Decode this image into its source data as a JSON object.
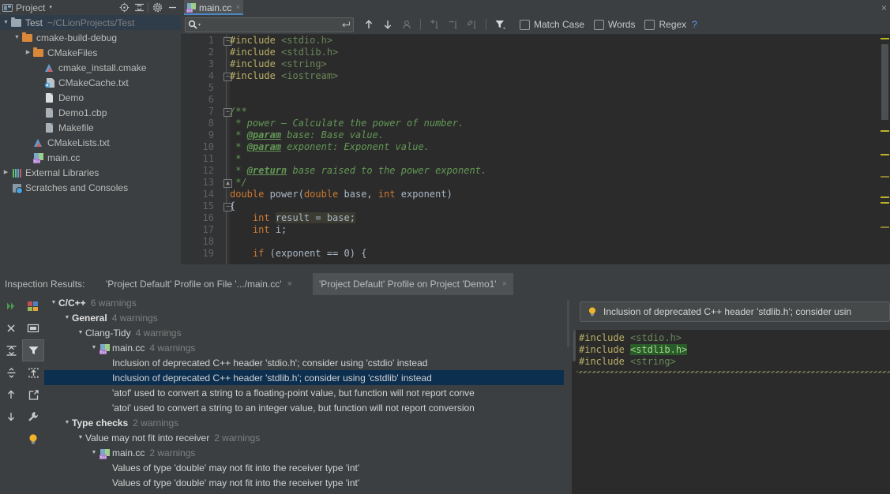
{
  "project_panel": {
    "title": "Project",
    "caret": "▾",
    "icons": [
      "project-icon",
      "locate-icon",
      "collapse-all-icon",
      "settings-gear-icon",
      "minimize-icon"
    ],
    "tree": [
      {
        "label": "Test",
        "sub": "~/CLionProjects/Test",
        "arrow": "▼",
        "icon": "folder-gray",
        "indent": 0,
        "selected": true
      },
      {
        "label": "cmake-build-debug",
        "sub": "",
        "arrow": "▼",
        "icon": "folder-orange",
        "indent": 1,
        "selected": false
      },
      {
        "label": "CMakeFiles",
        "sub": "",
        "arrow": "▶",
        "icon": "folder-orange",
        "indent": 2,
        "selected": false
      },
      {
        "label": "cmake_install.cmake",
        "sub": "",
        "arrow": "",
        "icon": "cmake-icon",
        "indent": 3,
        "selected": false
      },
      {
        "label": "CMakeCache.txt",
        "sub": "",
        "arrow": "",
        "icon": "cmake-cache-icon",
        "indent": 3,
        "selected": false
      },
      {
        "label": "Demo",
        "sub": "",
        "arrow": "",
        "icon": "file-white-icon",
        "indent": 3,
        "selected": false
      },
      {
        "label": "Demo1.cbp",
        "sub": "",
        "arrow": "",
        "icon": "file-gray-icon",
        "indent": 3,
        "selected": false
      },
      {
        "label": "Makefile",
        "sub": "",
        "arrow": "",
        "icon": "file-gray-icon",
        "indent": 3,
        "selected": false
      },
      {
        "label": "CMakeLists.txt",
        "sub": "",
        "arrow": "",
        "icon": "cmake-icon",
        "indent": 2,
        "selected": false
      },
      {
        "label": "main.cc",
        "sub": "",
        "arrow": "",
        "icon": "cpp-file-icon",
        "indent": 2,
        "selected": false
      },
      {
        "label": "External Libraries",
        "sub": "",
        "arrow": "▶",
        "icon": "libraries-icon",
        "indent": 0,
        "selected": false
      },
      {
        "label": "Scratches and Consoles",
        "sub": "",
        "arrow": "",
        "icon": "scratches-icon",
        "indent": 0,
        "selected": false
      }
    ]
  },
  "editor": {
    "tab": {
      "label": "main.cc",
      "close": "×",
      "icon": "cpp-file-icon"
    },
    "tabbar_close": "×",
    "search": {
      "value": "",
      "placeholder": "",
      "magnifier": "search-icon",
      "dropdown": "▾",
      "enter_key": "enter-key-icon"
    },
    "toolbar_buttons": [
      {
        "name": "find-previous-icon",
        "glyph": "↑"
      },
      {
        "name": "find-next-icon",
        "glyph": "↓"
      },
      {
        "name": "select-all-occurrences-icon",
        "glyph": "●"
      },
      {
        "name": "add-line-icon",
        "glyph": ""
      },
      {
        "name": "remove-line-icon",
        "glyph": ""
      },
      {
        "name": "edit-line-icon",
        "glyph": ""
      },
      {
        "name": "filter-icon",
        "glyph": ""
      }
    ],
    "checkboxes": [
      {
        "label": "Match Case",
        "checked": false
      },
      {
        "label": "Words",
        "checked": false
      },
      {
        "label": "Regex",
        "checked": false
      }
    ],
    "help": "?",
    "help_color": "#589df6",
    "lines": [
      {
        "num": "1",
        "fold": "−",
        "tokens": [
          {
            "t": "#include ",
            "c": "inc"
          },
          {
            "t": "<stdio.h>",
            "c": "str"
          }
        ]
      },
      {
        "num": "2",
        "fold": "",
        "tokens": [
          {
            "t": "#include ",
            "c": "inc"
          },
          {
            "t": "<stdlib.h>",
            "c": "str"
          }
        ]
      },
      {
        "num": "3",
        "fold": "",
        "tokens": [
          {
            "t": "#include ",
            "c": "inc"
          },
          {
            "t": "<string>",
            "c": "str"
          }
        ]
      },
      {
        "num": "4",
        "fold": "−",
        "tokens": [
          {
            "t": "#include ",
            "c": "inc"
          },
          {
            "t": "<iostream>",
            "c": "str"
          }
        ]
      },
      {
        "num": "5",
        "fold": "",
        "tokens": []
      },
      {
        "num": "6",
        "fold": "",
        "tokens": []
      },
      {
        "num": "7",
        "fold": "−",
        "tokens": [
          {
            "t": "/**",
            "c": "cmt"
          }
        ]
      },
      {
        "num": "8",
        "fold": "",
        "tokens": [
          {
            "t": " * power – Calculate the power of number.",
            "c": "cmt"
          }
        ]
      },
      {
        "num": "9",
        "fold": "",
        "tokens": [
          {
            "t": " * ",
            "c": "cmt"
          },
          {
            "t": "@param",
            "c": "tag"
          },
          {
            "t": " base: Base value.",
            "c": "cmt"
          }
        ]
      },
      {
        "num": "10",
        "fold": "",
        "tokens": [
          {
            "t": " * ",
            "c": "cmt"
          },
          {
            "t": "@param",
            "c": "tag"
          },
          {
            "t": " exponent: Exponent value.",
            "c": "cmt"
          }
        ]
      },
      {
        "num": "11",
        "fold": "",
        "tokens": [
          {
            "t": " *",
            "c": "cmt"
          }
        ]
      },
      {
        "num": "12",
        "fold": "",
        "tokens": [
          {
            "t": " * ",
            "c": "cmt"
          },
          {
            "t": "@return",
            "c": "tag"
          },
          {
            "t": " base raised to the power exponent.",
            "c": "cmt"
          }
        ]
      },
      {
        "num": "13",
        "fold": "▲",
        "tokens": [
          {
            "t": " */",
            "c": "cmt"
          }
        ]
      },
      {
        "num": "14",
        "fold": "",
        "tokens": [
          {
            "t": "double ",
            "c": "kw"
          },
          {
            "t": "power(",
            "c": "pln"
          },
          {
            "t": "double ",
            "c": "kw"
          },
          {
            "t": "base, ",
            "c": "pln"
          },
          {
            "t": "int ",
            "c": "kw"
          },
          {
            "t": "exponent)",
            "c": "pln"
          }
        ]
      },
      {
        "num": "15",
        "fold": "−",
        "tokens": [
          {
            "t": "{",
            "c": "pln"
          }
        ]
      },
      {
        "num": "16",
        "fold": "",
        "tokens": [
          {
            "t": "    ",
            "c": "pln"
          },
          {
            "t": "int ",
            "c": "kw"
          },
          {
            "t": "result = base;",
            "c": "pln hl"
          }
        ]
      },
      {
        "num": "17",
        "fold": "",
        "tokens": [
          {
            "t": "    ",
            "c": "pln"
          },
          {
            "t": "int ",
            "c": "kw"
          },
          {
            "t": "i;",
            "c": "pln"
          }
        ]
      },
      {
        "num": "18",
        "fold": "",
        "tokens": []
      },
      {
        "num": "19",
        "fold": "",
        "tokens": [
          {
            "t": "    ",
            "c": "pln"
          },
          {
            "t": "if ",
            "c": "kw"
          },
          {
            "t": "(exponent == 0) {",
            "c": "pln"
          }
        ]
      }
    ],
    "scroll_markers": [
      "#bbb529",
      "#bbb529",
      "#bbb529",
      "#8a7f33",
      "#bbb529",
      "#bbb529",
      "#8a7f33"
    ]
  },
  "inspection": {
    "label": "Inspection Results:",
    "tabs": [
      {
        "label": "'Project Default' Profile on File '.../main.cc'",
        "close": "×",
        "active": false
      },
      {
        "label": "'Project Default' Profile on Project 'Demo1'",
        "close": "×",
        "active": true
      }
    ],
    "toolbar_col1": [
      {
        "name": "rerun-inspection-icon"
      },
      {
        "name": "close-inspection-icon"
      },
      {
        "name": "expand-all-icon"
      },
      {
        "name": "collapse-all-icon"
      },
      {
        "name": "previous-occurrence-icon"
      },
      {
        "name": "next-occurrence-icon"
      }
    ],
    "toolbar_col2": [
      {
        "name": "group-by-severity-icon"
      },
      {
        "name": "group-by-directory-icon"
      },
      {
        "name": "filter-resolved-icon",
        "active": true
      },
      {
        "name": "export-icon"
      },
      {
        "name": "open-in-editor-icon"
      },
      {
        "name": "settings-wrench-icon"
      },
      {
        "name": "quick-fix-bulb-icon"
      }
    ],
    "tree": [
      {
        "arrow": "▼",
        "label": "C/C++",
        "bold": true,
        "count": "6 warnings",
        "indent": 0,
        "icon": "",
        "selected": false
      },
      {
        "arrow": "▼",
        "label": "General",
        "bold": true,
        "count": "4 warnings",
        "indent": 1,
        "icon": "",
        "selected": false
      },
      {
        "arrow": "▼",
        "label": "Clang-Tidy",
        "bold": false,
        "count": "4 warnings",
        "indent": 2,
        "icon": "",
        "selected": false
      },
      {
        "arrow": "▼",
        "label": "main.cc",
        "bold": false,
        "count": "4 warnings",
        "indent": 3,
        "icon": "cpp-file-icon",
        "selected": false
      },
      {
        "arrow": "",
        "label": "Inclusion of deprecated C++ header 'stdio.h'; consider using 'cstdio' instead",
        "bold": false,
        "count": "",
        "indent": 4,
        "icon": "",
        "selected": false
      },
      {
        "arrow": "",
        "label": "Inclusion of deprecated C++ header 'stdlib.h'; consider using 'cstdlib' instead",
        "bold": false,
        "count": "",
        "indent": 4,
        "icon": "",
        "selected": true
      },
      {
        "arrow": "",
        "label": "'atof' used to convert a string to a floating-point value, but function will not report conve",
        "bold": false,
        "count": "",
        "indent": 4,
        "icon": "",
        "selected": false
      },
      {
        "arrow": "",
        "label": "'atoi' used to convert a string to an integer value, but function will not report conversion",
        "bold": false,
        "count": "",
        "indent": 4,
        "icon": "",
        "selected": false
      },
      {
        "arrow": "▼",
        "label": "Type checks",
        "bold": true,
        "count": "2 warnings",
        "indent": 1,
        "icon": "",
        "selected": false
      },
      {
        "arrow": "▼",
        "label": "Value may not fit into receiver",
        "bold": false,
        "count": "2 warnings",
        "indent": 2,
        "icon": "",
        "selected": false
      },
      {
        "arrow": "▼",
        "label": "main.cc",
        "bold": false,
        "count": "2 warnings",
        "indent": 3,
        "icon": "cpp-file-icon",
        "selected": false
      },
      {
        "arrow": "",
        "label": "Values of type 'double' may not fit into the receiver type 'int'",
        "bold": false,
        "count": "",
        "indent": 4,
        "icon": "",
        "selected": false
      },
      {
        "arrow": "",
        "label": "Values of type 'double' may not fit into the receiver type 'int'",
        "bold": false,
        "count": "",
        "indent": 4,
        "icon": "",
        "selected": false
      }
    ],
    "preview": {
      "banner_icon": "warning-bulb-icon",
      "banner_text": "Inclusion of deprecated C++ header 'stdlib.h'; consider usin",
      "code": [
        [
          {
            "t": "#include ",
            "c": "inc"
          },
          {
            "t": "<stdio.h>",
            "c": "str"
          }
        ],
        [
          {
            "t": "#include ",
            "c": "inc"
          },
          {
            "t": "<stdlib.h>",
            "c": "ghl"
          }
        ],
        [
          {
            "t": "#include ",
            "c": "inc"
          },
          {
            "t": "<string>",
            "c": "str"
          }
        ]
      ]
    }
  },
  "colors": {
    "bg_panel": "#3c3f41",
    "bg_editor": "#2b2b2b",
    "selection": "#0d2f4f",
    "accent_blue": "#4a88c7",
    "warning_yellow": "#bbb529",
    "string_green": "#6a8759",
    "keyword_orange": "#cc7832"
  }
}
